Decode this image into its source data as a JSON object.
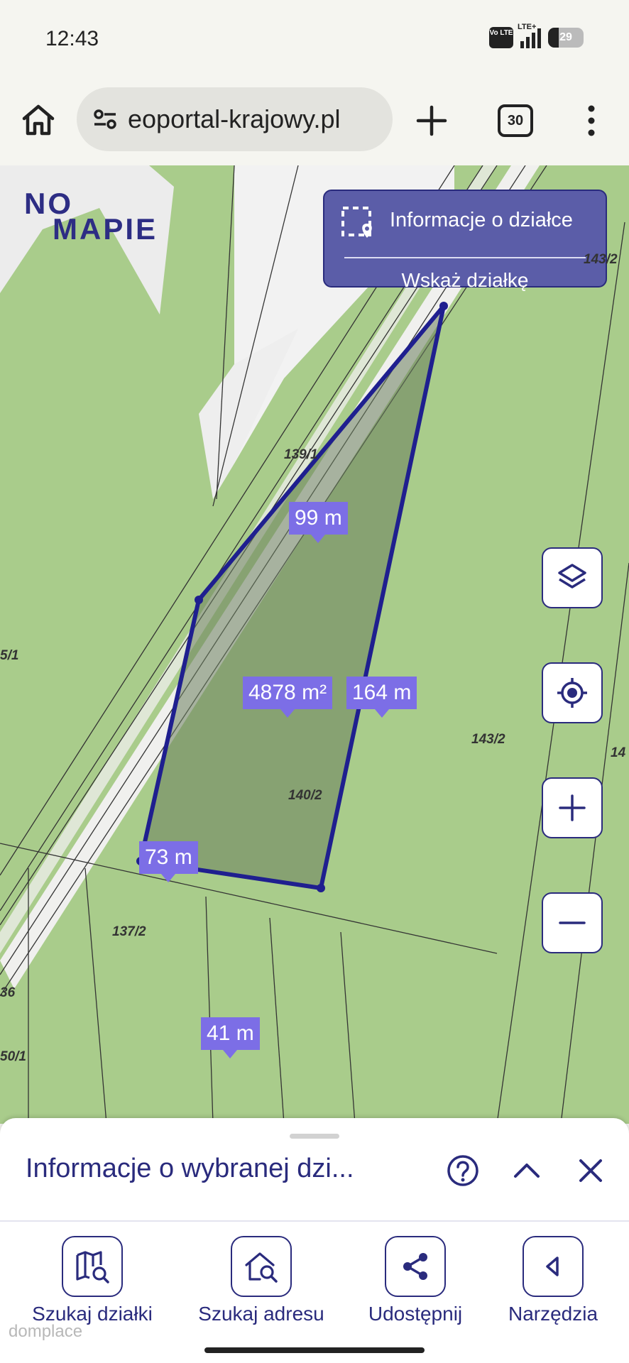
{
  "status_bar": {
    "time": "12:43",
    "volte_label": "Vo LTE",
    "network": "LTE+",
    "battery_level": "29"
  },
  "browser": {
    "url_text": "eoportal-krajowy.pl",
    "tab_count": "30",
    "icons": [
      "home-icon",
      "site-settings-icon",
      "new-tab-icon",
      "tabs-icon",
      "more-vertical-icon"
    ]
  },
  "map": {
    "brand_top": "NO",
    "brand_bottom": "MAPIE",
    "info_panel": {
      "title": "Informacje o działce",
      "action": "Wskaż działkę"
    },
    "parcel_labels": {
      "p139_1": "139/1",
      "p143_2_a": "143/2",
      "p143_2_b": "143/2",
      "p140_2": "140/2",
      "p137_2": "137/2",
      "p5_1": "5/1",
      "p36": "36",
      "p50_1": "50/1",
      "p14": "14"
    },
    "measurements": {
      "top_edge": "99 m",
      "area": "4878 m²",
      "right_edge": "164 m",
      "left_edge": "73 m",
      "bottom_edge": "41 m"
    },
    "controls": [
      "layers-icon",
      "locate-icon",
      "zoom-in-icon",
      "zoom-out-icon"
    ],
    "colors": {
      "map_green": "#a9cc8b",
      "parcel_outline": "#1f1f8f",
      "measure_badge": "#7c6ee6",
      "panel_bg": "#5b5da8"
    }
  },
  "sheet": {
    "title": "Informacje o wybranej dzi...",
    "icons": [
      "help-icon",
      "chevron-up-icon",
      "close-icon"
    ],
    "tools": [
      {
        "label": "Szukaj działki",
        "icon": "map-search-icon"
      },
      {
        "label": "Szukaj adresu",
        "icon": "home-search-icon"
      },
      {
        "label": "Udostępnij",
        "icon": "share-icon"
      },
      {
        "label": "Narzędzia",
        "icon": "chevron-left-icon"
      }
    ]
  },
  "watermark": "domplace"
}
